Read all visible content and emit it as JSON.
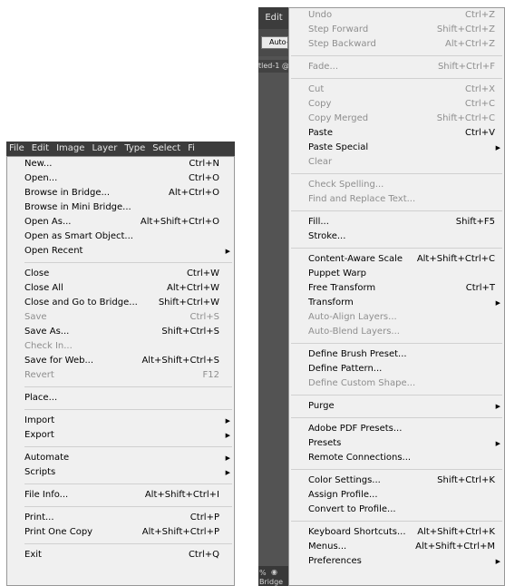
{
  "menubar": {
    "items": [
      "File",
      "Edit",
      "Image",
      "Layer",
      "Type",
      "Select",
      "Fi"
    ]
  },
  "file_menu": [
    {
      "label": "New...",
      "shortcut": "Ctrl+N"
    },
    {
      "label": "Open...",
      "shortcut": "Ctrl+O"
    },
    {
      "label": "Browse in Bridge...",
      "shortcut": "Alt+Ctrl+O"
    },
    {
      "label": "Browse in Mini Bridge...",
      "shortcut": ""
    },
    {
      "label": "Open As...",
      "shortcut": "Alt+Shift+Ctrl+O"
    },
    {
      "label": "Open as Smart Object...",
      "shortcut": ""
    },
    {
      "label": "Open Recent",
      "shortcut": "",
      "submenu": true
    },
    {
      "sep": true
    },
    {
      "label": "Close",
      "shortcut": "Ctrl+W"
    },
    {
      "label": "Close All",
      "shortcut": "Alt+Ctrl+W"
    },
    {
      "label": "Close and Go to Bridge...",
      "shortcut": "Shift+Ctrl+W"
    },
    {
      "label": "Save",
      "shortcut": "Ctrl+S",
      "disabled": true
    },
    {
      "label": "Save As...",
      "shortcut": "Shift+Ctrl+S"
    },
    {
      "label": "Check In...",
      "shortcut": "",
      "disabled": true
    },
    {
      "label": "Save for Web...",
      "shortcut": "Alt+Shift+Ctrl+S"
    },
    {
      "label": "Revert",
      "shortcut": "F12",
      "disabled": true
    },
    {
      "sep": true
    },
    {
      "label": "Place...",
      "shortcut": ""
    },
    {
      "sep": true
    },
    {
      "label": "Import",
      "shortcut": "",
      "submenu": true
    },
    {
      "label": "Export",
      "shortcut": "",
      "submenu": true
    },
    {
      "sep": true
    },
    {
      "label": "Automate",
      "shortcut": "",
      "submenu": true
    },
    {
      "label": "Scripts",
      "shortcut": "",
      "submenu": true
    },
    {
      "sep": true
    },
    {
      "label": "File Info...",
      "shortcut": "Alt+Shift+Ctrl+I"
    },
    {
      "sep": true
    },
    {
      "label": "Print...",
      "shortcut": "Ctrl+P"
    },
    {
      "label": "Print One Copy",
      "shortcut": "Alt+Shift+Ctrl+P"
    },
    {
      "sep": true
    },
    {
      "label": "Exit",
      "shortcut": "Ctrl+Q"
    }
  ],
  "edit_app": {
    "tab_label": "Edit",
    "option_text": "Auto-",
    "doc_tab": "tled-1 @",
    "status_pct": "%",
    "status_bridge": "Bridge"
  },
  "edit_menu": [
    {
      "label": "Undo",
      "shortcut": "Ctrl+Z",
      "disabled": true
    },
    {
      "label": "Step Forward",
      "shortcut": "Shift+Ctrl+Z",
      "disabled": true
    },
    {
      "label": "Step Backward",
      "shortcut": "Alt+Ctrl+Z",
      "disabled": true
    },
    {
      "sep": true
    },
    {
      "label": "Fade...",
      "shortcut": "Shift+Ctrl+F",
      "disabled": true
    },
    {
      "sep": true
    },
    {
      "label": "Cut",
      "shortcut": "Ctrl+X",
      "disabled": true
    },
    {
      "label": "Copy",
      "shortcut": "Ctrl+C",
      "disabled": true
    },
    {
      "label": "Copy Merged",
      "shortcut": "Shift+Ctrl+C",
      "disabled": true
    },
    {
      "label": "Paste",
      "shortcut": "Ctrl+V"
    },
    {
      "label": "Paste Special",
      "shortcut": "",
      "submenu": true
    },
    {
      "label": "Clear",
      "shortcut": "",
      "disabled": true
    },
    {
      "sep": true
    },
    {
      "label": "Check Spelling...",
      "shortcut": "",
      "disabled": true
    },
    {
      "label": "Find and Replace Text...",
      "shortcut": "",
      "disabled": true
    },
    {
      "sep": true
    },
    {
      "label": "Fill...",
      "shortcut": "Shift+F5"
    },
    {
      "label": "Stroke...",
      "shortcut": ""
    },
    {
      "sep": true
    },
    {
      "label": "Content-Aware Scale",
      "shortcut": "Alt+Shift+Ctrl+C"
    },
    {
      "label": "Puppet Warp",
      "shortcut": ""
    },
    {
      "label": "Free Transform",
      "shortcut": "Ctrl+T"
    },
    {
      "label": "Transform",
      "shortcut": "",
      "submenu": true
    },
    {
      "label": "Auto-Align Layers...",
      "shortcut": "",
      "disabled": true
    },
    {
      "label": "Auto-Blend Layers...",
      "shortcut": "",
      "disabled": true
    },
    {
      "sep": true
    },
    {
      "label": "Define Brush Preset...",
      "shortcut": ""
    },
    {
      "label": "Define Pattern...",
      "shortcut": ""
    },
    {
      "label": "Define Custom Shape...",
      "shortcut": "",
      "disabled": true
    },
    {
      "sep": true
    },
    {
      "label": "Purge",
      "shortcut": "",
      "submenu": true
    },
    {
      "sep": true
    },
    {
      "label": "Adobe PDF Presets...",
      "shortcut": ""
    },
    {
      "label": "Presets",
      "shortcut": "",
      "submenu": true
    },
    {
      "label": "Remote Connections...",
      "shortcut": ""
    },
    {
      "sep": true
    },
    {
      "label": "Color Settings...",
      "shortcut": "Shift+Ctrl+K"
    },
    {
      "label": "Assign Profile...",
      "shortcut": ""
    },
    {
      "label": "Convert to Profile...",
      "shortcut": ""
    },
    {
      "sep": true
    },
    {
      "label": "Keyboard Shortcuts...",
      "shortcut": "Alt+Shift+Ctrl+K"
    },
    {
      "label": "Menus...",
      "shortcut": "Alt+Shift+Ctrl+M"
    },
    {
      "label": "Preferences",
      "shortcut": "",
      "submenu": true
    }
  ],
  "icons": {
    "submenu_arrow": "triangle-right",
    "camera": "camera"
  }
}
